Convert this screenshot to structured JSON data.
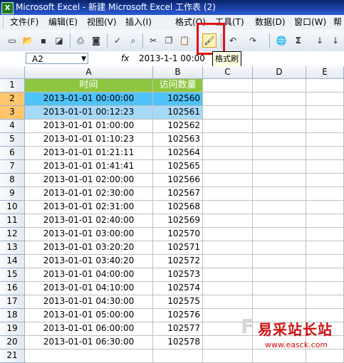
{
  "window": {
    "title": "Microsoft Excel - 新建 Microsoft Excel 工作表 (2)",
    "app_icon": "excel-icon"
  },
  "menu": [
    {
      "label": "文件(F)"
    },
    {
      "label": "编辑(E)"
    },
    {
      "label": "视图(V)"
    },
    {
      "label": "插入(I)"
    },
    {
      "label": "格式(O)"
    },
    {
      "label": "工具(T)"
    },
    {
      "label": "数据(D)"
    },
    {
      "label": "窗口(W)"
    },
    {
      "label": "帮"
    }
  ],
  "toolbar": {
    "icons": [
      "new-icon",
      "open-icon",
      "save-icon",
      "permission-icon",
      "print-icon",
      "print-preview-icon",
      "spelling-icon",
      "research-icon",
      "cut-icon",
      "copy-icon",
      "paste-icon",
      "format-painter-icon",
      "undo-icon",
      "redo-icon",
      "hyperlink-icon",
      "autosum-icon",
      "sort-asc-icon"
    ],
    "tooltip": "格式刷",
    "sigma": "Σ"
  },
  "formula_bar": {
    "name_box": "A2",
    "fx": "fx",
    "value": "2013-1-1  00:00"
  },
  "columns": [
    "A",
    "B",
    "C",
    "D",
    "E"
  ],
  "header_row": {
    "row": "1",
    "a": "时间",
    "b": "访问数量"
  },
  "rows": [
    {
      "n": "2",
      "a": "2013-01-01 00:00:00",
      "b": "102560"
    },
    {
      "n": "3",
      "a": "2013-01-01 00:12:23",
      "b": "102561"
    },
    {
      "n": "4",
      "a": "2013-01-01 01:00:00",
      "b": "102562"
    },
    {
      "n": "5",
      "a": "2013-01-01 01:10:23",
      "b": "102563"
    },
    {
      "n": "6",
      "a": "2013-01-01 01:21:11",
      "b": "102564"
    },
    {
      "n": "7",
      "a": "2013-01-01 01:41:41",
      "b": "102565"
    },
    {
      "n": "8",
      "a": "2013-01-01 02:00:00",
      "b": "102566"
    },
    {
      "n": "9",
      "a": "2013-01-01 02:30:00",
      "b": "102567"
    },
    {
      "n": "10",
      "a": "2013-01-01 02:31:00",
      "b": "102568"
    },
    {
      "n": "11",
      "a": "2013-01-01 02:40:00",
      "b": "102569"
    },
    {
      "n": "12",
      "a": "2013-01-01 03:00:00",
      "b": "102570"
    },
    {
      "n": "13",
      "a": "2013-01-01 03:20:20",
      "b": "102571"
    },
    {
      "n": "14",
      "a": "2013-01-01 03:40:20",
      "b": "102572"
    },
    {
      "n": "15",
      "a": "2013-01-01 04:00:00",
      "b": "102573"
    },
    {
      "n": "16",
      "a": "2013-01-01 04:10:00",
      "b": "102574"
    },
    {
      "n": "17",
      "a": "2013-01-01 04:30:00",
      "b": "102575"
    },
    {
      "n": "18",
      "a": "2013-01-01 05:00:00",
      "b": "102576"
    },
    {
      "n": "19",
      "a": "2013-01-01 06:00:00",
      "b": "102577"
    },
    {
      "n": "20",
      "a": "2013-01-01 06:30:00",
      "b": "102578"
    },
    {
      "n": "21",
      "a": "",
      "b": ""
    }
  ],
  "watermark": {
    "cn": "易采站长站",
    "url": "www.easck.com",
    "logo": "F"
  },
  "colors": {
    "header_green": "#8fc641",
    "selected_row_2": "#4fc3f7",
    "selected_row_3": "#a6d9f7",
    "highlight_red": "#e01010"
  }
}
